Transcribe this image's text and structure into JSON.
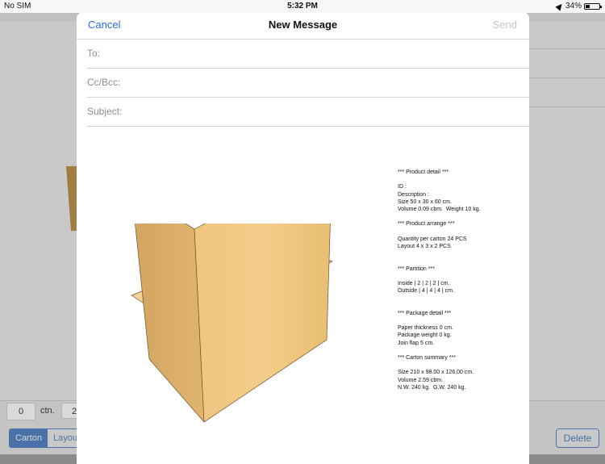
{
  "status_bar": {
    "carrier": "No SIM",
    "time": "5:32 PM",
    "battery": "34%",
    "battery_level": 0.34
  },
  "mail": {
    "cancel_label": "Cancel",
    "title": "New Message",
    "send_label": "Send",
    "to_label": "To:",
    "ccbcc_label": "Cc/Bcc:",
    "subject_label": "Subject:"
  },
  "report_lines": [
    "*** Product detail ***",
    "",
    "ID :",
    "Description :",
    "Size 50 x 30 x 60 cm.",
    "Volume 0.09 cbm.  Weight 10 kg.",
    "",
    "*** Product arrange ***",
    "",
    "Quantity per carton 24 PCS",
    "Layout 4 x 3 x 2 PCS",
    "",
    "",
    "*** Partition ***",
    "",
    "Inside | 2 | 2 | 2 | cm.",
    "Outside | 4 | 4 | 4 | cm.",
    "",
    "",
    "*** Package detail ***",
    "",
    "Paper thickness 0 cm.",
    "Package weight 0 kg.",
    "Join flap 5 cm.",
    "",
    "*** Carton summary ***",
    "",
    "Size 210 x 98.00 x 126.00 cm.",
    "Volume 2.59 cbm.",
    "N.W. 240 kg.  G.W. 240 kg."
  ],
  "background": {
    "quantity_value": "0",
    "ctn_label": "ctn.",
    "second_value": "2",
    "segments": [
      "Carton",
      "Layout"
    ],
    "delete_label": "Delete"
  }
}
